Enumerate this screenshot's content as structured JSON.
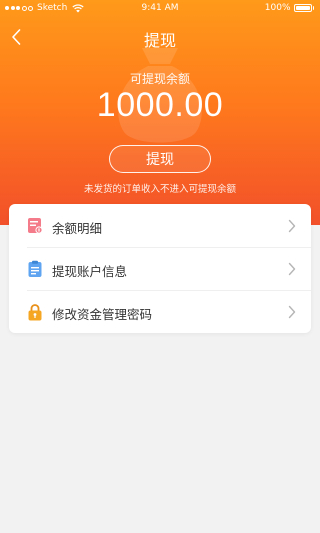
{
  "status_bar": {
    "carrier": "Sketch",
    "time": "9:41 AM",
    "battery": "100%"
  },
  "nav": {
    "title": "提现"
  },
  "balance": {
    "label": "可提现余额",
    "amount": "1000.00"
  },
  "actions": {
    "withdraw_label": "提现"
  },
  "hint": "未发货的订单收入不进入可提现余额",
  "menu": {
    "items": [
      {
        "label": "余额明细",
        "icon": "balance-detail-icon"
      },
      {
        "label": "提现账户信息",
        "icon": "account-info-icon"
      },
      {
        "label": "修改资金管理密码",
        "icon": "lock-icon"
      }
    ]
  },
  "colors": {
    "header_top": "#ff9a1a",
    "header_bottom": "#f2502a",
    "background": "#f2f2f2",
    "icon_pink": "#f47b8a",
    "icon_blue": "#5fa4f0",
    "icon_orange": "#f5a623"
  }
}
